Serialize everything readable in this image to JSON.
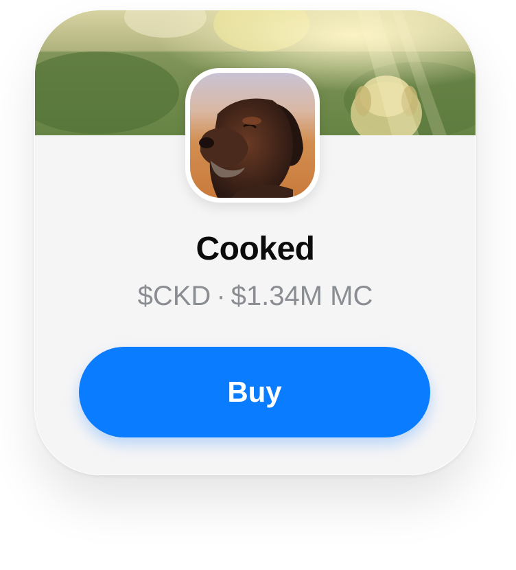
{
  "token": {
    "name": "Cooked",
    "ticker": "$CKD",
    "separator": "·",
    "market_cap": "$1.34M MC"
  },
  "actions": {
    "buy_label": "Buy"
  },
  "colors": {
    "accent": "#0a7cff",
    "card_background": "#f5f5f6",
    "subtitle_text": "#8a8d92"
  },
  "images": {
    "banner": "banner-image",
    "avatar": "dog-avatar-image"
  }
}
